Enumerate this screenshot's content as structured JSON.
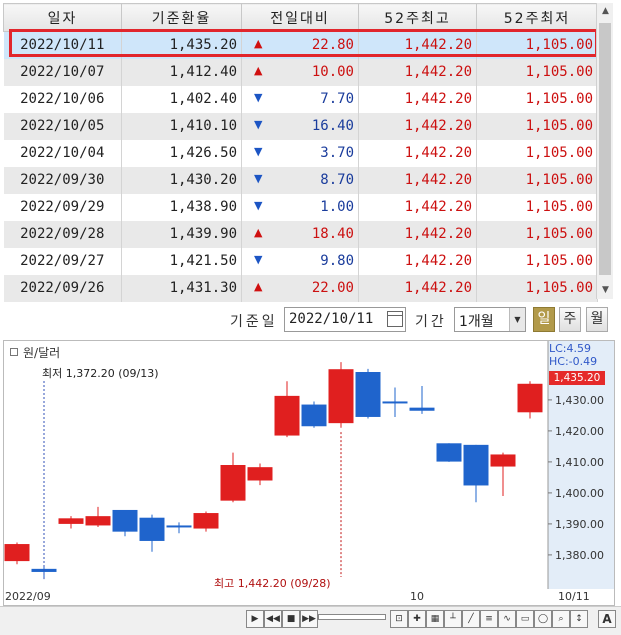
{
  "table": {
    "headers": [
      "일자",
      "기준환율",
      "전일대비",
      "52주최고",
      "52주최저"
    ],
    "rows": [
      {
        "date": "2022/10/11",
        "rate": "1,435.20",
        "dir": "up",
        "change": "22.80",
        "high": "1,442.20",
        "low": "1,105.00"
      },
      {
        "date": "2022/10/07",
        "rate": "1,412.40",
        "dir": "up",
        "change": "10.00",
        "high": "1,442.20",
        "low": "1,105.00"
      },
      {
        "date": "2022/10/06",
        "rate": "1,402.40",
        "dir": "down",
        "change": "7.70",
        "high": "1,442.20",
        "low": "1,105.00"
      },
      {
        "date": "2022/10/05",
        "rate": "1,410.10",
        "dir": "down",
        "change": "16.40",
        "high": "1,442.20",
        "low": "1,105.00"
      },
      {
        "date": "2022/10/04",
        "rate": "1,426.50",
        "dir": "down",
        "change": "3.70",
        "high": "1,442.20",
        "low": "1,105.00"
      },
      {
        "date": "2022/09/30",
        "rate": "1,430.20",
        "dir": "down",
        "change": "8.70",
        "high": "1,442.20",
        "low": "1,105.00"
      },
      {
        "date": "2022/09/29",
        "rate": "1,438.90",
        "dir": "down",
        "change": "1.00",
        "high": "1,442.20",
        "low": "1,105.00"
      },
      {
        "date": "2022/09/28",
        "rate": "1,439.90",
        "dir": "up",
        "change": "18.40",
        "high": "1,442.20",
        "low": "1,105.00"
      },
      {
        "date": "2022/09/27",
        "rate": "1,421.50",
        "dir": "down",
        "change": "9.80",
        "high": "1,442.20",
        "low": "1,105.00"
      },
      {
        "date": "2022/09/26",
        "rate": "1,431.30",
        "dir": "up",
        "change": "22.00",
        "high": "1,442.20",
        "low": "1,105.00"
      }
    ]
  },
  "icons": {
    "up": "▲",
    "down": "▼",
    "scroll_up": "▲",
    "scroll_down": "▼",
    "dropdown": "▼"
  },
  "controls": {
    "base_date_label": "기준일",
    "base_date_value": "2022/10/11",
    "period_label": "기간",
    "period_value": "1개월",
    "period_buttons": [
      "일",
      "주",
      "월"
    ],
    "active_period": "일"
  },
  "chart_data": {
    "type": "candlestick",
    "title": "원/달러",
    "lc_text": "LC:4.59",
    "hc_text": "HC:-0.49",
    "current_price_label": "1,435.20",
    "min_annotation": "최저 1,372.20 (09/13)",
    "max_annotation": "최고 1,442.20 (09/28)",
    "ylim": [
      1369,
      1449
    ],
    "y_ticks": [
      "1,430.00",
      "1,420.00",
      "1,410.00",
      "1,400.00",
      "1,390.00",
      "1,380.00"
    ],
    "y_tick_values": [
      1430,
      1420,
      1410,
      1400,
      1390,
      1380
    ],
    "x_labels": [
      "2022/09",
      "10",
      "10/11"
    ],
    "candles": [
      {
        "o": 1378.0,
        "h": 1384.0,
        "l": 1377.0,
        "c": 1383.5
      },
      {
        "o": 1375.5,
        "h": 1376.5,
        "l": 1372.2,
        "c": 1374.5
      },
      {
        "o": 1390.0,
        "h": 1392.5,
        "l": 1388.5,
        "c": 1391.8
      },
      {
        "o": 1389.5,
        "h": 1395.5,
        "l": 1389.0,
        "c": 1392.5
      },
      {
        "o": 1394.5,
        "h": 1394.5,
        "l": 1386.0,
        "c": 1387.5
      },
      {
        "o": 1392.0,
        "h": 1393.0,
        "l": 1381.0,
        "c": 1384.5
      },
      {
        "o": 1389.5,
        "h": 1390.5,
        "l": 1387.0,
        "c": 1389.0
      },
      {
        "o": 1388.5,
        "h": 1394.0,
        "l": 1387.5,
        "c": 1393.5
      },
      {
        "o": 1397.5,
        "h": 1413.0,
        "l": 1397.0,
        "c": 1409.0
      },
      {
        "o": 1404.0,
        "h": 1409.5,
        "l": 1402.5,
        "c": 1408.3
      },
      {
        "o": 1418.5,
        "h": 1436.0,
        "l": 1418.0,
        "c": 1431.3
      },
      {
        "o": 1428.5,
        "h": 1429.5,
        "l": 1421.0,
        "c": 1421.5
      },
      {
        "o": 1422.5,
        "h": 1442.2,
        "l": 1421.0,
        "c": 1439.9
      },
      {
        "o": 1439.0,
        "h": 1440.0,
        "l": 1424.0,
        "c": 1424.5
      },
      {
        "o": 1429.5,
        "h": 1434.0,
        "l": 1424.5,
        "c": 1429.0
      },
      {
        "o": 1427.5,
        "h": 1434.5,
        "l": 1425.5,
        "c": 1426.5
      },
      {
        "o": 1416.0,
        "h": 1416.0,
        "l": 1410.0,
        "c": 1410.1
      },
      {
        "o": 1415.5,
        "h": 1415.5,
        "l": 1397.0,
        "c": 1402.4
      },
      {
        "o": 1408.5,
        "h": 1413.0,
        "l": 1399.0,
        "c": 1412.4
      },
      {
        "o": 1426.0,
        "h": 1436.0,
        "l": 1424.0,
        "c": 1435.2
      }
    ],
    "colors": {
      "up": "#e01f1f",
      "down": "#1f64cc",
      "axis_bg": "#e3edf8",
      "grid": "#cfcfcf"
    }
  },
  "toolbar": {
    "zoom_label": "A"
  }
}
